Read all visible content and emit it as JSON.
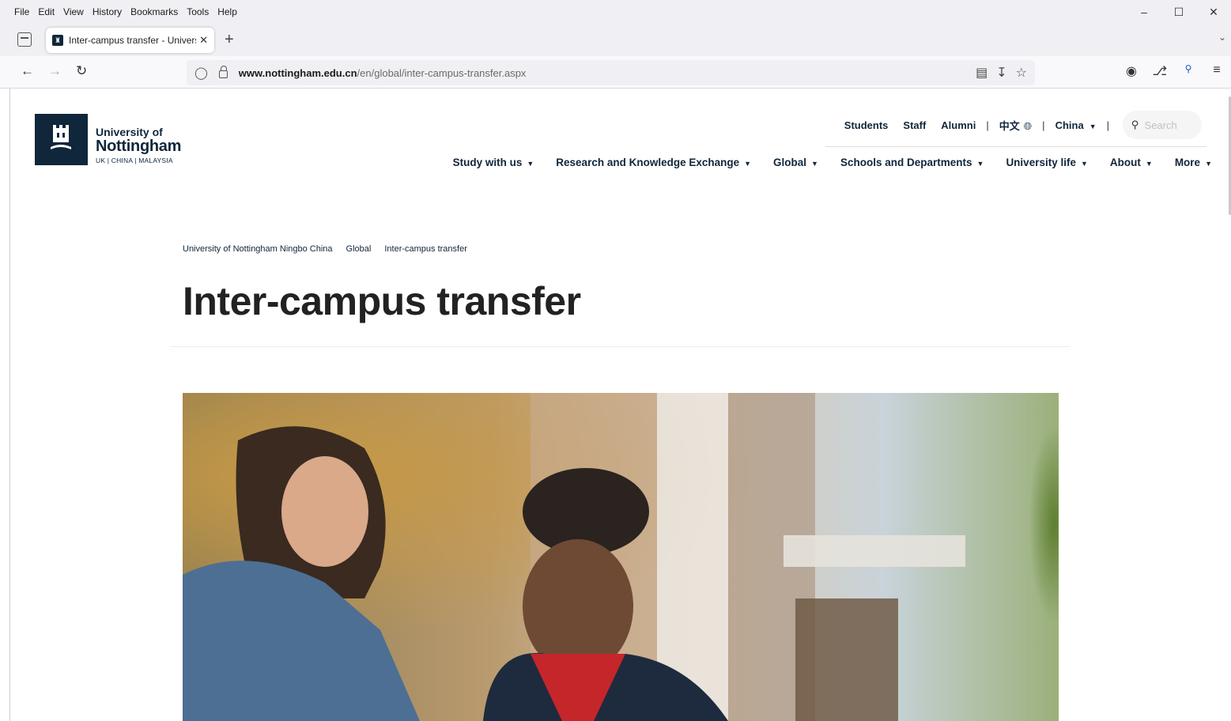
{
  "browser": {
    "menu": [
      "File",
      "Edit",
      "View",
      "History",
      "Bookmarks",
      "Tools",
      "Help"
    ],
    "tab_title": "Inter-campus transfer - Universi",
    "url_host": "www.nottingham.edu.cn",
    "url_path": "/en/global/inter-campus-transfer.aspx"
  },
  "site": {
    "logo": {
      "line1": "University of",
      "line2": "Nottingham",
      "line3": "UK | CHINA | MALAYSIA"
    },
    "utility_nav": {
      "students": "Students",
      "staff": "Staff",
      "alumni": "Alumni",
      "language": "中文",
      "region": "China",
      "search_placeholder": "Search"
    },
    "main_nav": [
      "Study with us",
      "Research and Knowledge Exchange",
      "Global",
      "Schools and Departments",
      "University life",
      "About",
      "More"
    ],
    "breadcrumb": [
      "University of Nottingham Ningbo China",
      "Global",
      "Inter-campus transfer"
    ],
    "page_title": "Inter-campus transfer"
  }
}
